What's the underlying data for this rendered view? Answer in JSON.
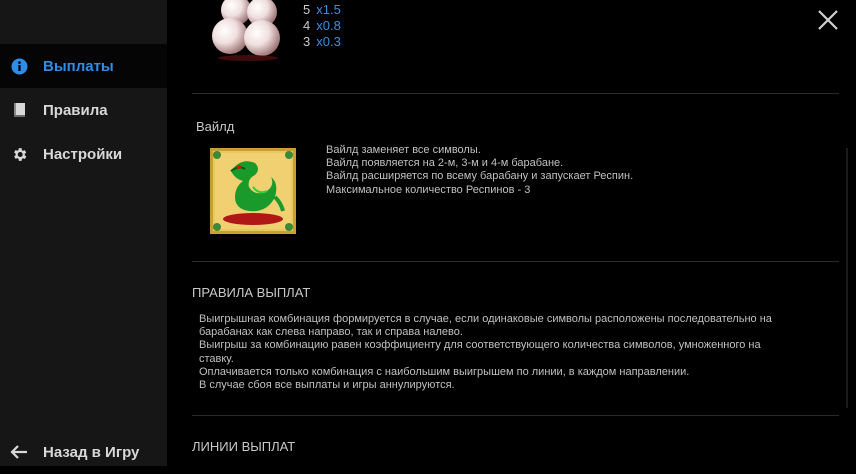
{
  "sidebar": {
    "items": [
      {
        "label": "Выплаты",
        "icon": "info-icon"
      },
      {
        "label": "Правила",
        "icon": "book-icon"
      },
      {
        "label": "Настройки",
        "icon": "gear-icon"
      }
    ],
    "back_label": "Назад в Игру"
  },
  "pearl_payouts": [
    {
      "count": "5",
      "multiplier": "x1.5"
    },
    {
      "count": "4",
      "multiplier": "x0.8"
    },
    {
      "count": "3",
      "multiplier": "x0.3"
    }
  ],
  "wild": {
    "title": "Вайлд",
    "lines": [
      "Вайлд заменяет все символы.",
      "Вайлд появляется на 2-м, 3-м и 4-м барабане.",
      "Вайлд расширяется по всему барабану и запускает Респин.",
      "Максимальное количество Респинов - 3"
    ]
  },
  "payout_rules": {
    "title": "ПРАВИЛА ВЫПЛАТ",
    "lines": [
      "Выигрышная комбинация формируется в случае, если одинаковые символы расположены последовательно на",
      "барабанах как слева направо, так и справа налево.",
      "Выигрыш за комбинацию равен коэффициенту для соответствующего количества символов, умноженного на",
      "ставку.",
      "Оплачивается только комбинация с наибольшим выигрышем по линии, в каждом направлении.",
      "В случае сбоя все выплаты и игры аннулируются."
    ]
  },
  "paylines": {
    "title": "ЛИНИИ ВЫПЛАТ"
  },
  "colors": {
    "accent": "#2f8ce8",
    "sidebar_bg": "#161616",
    "background": "#000000"
  }
}
